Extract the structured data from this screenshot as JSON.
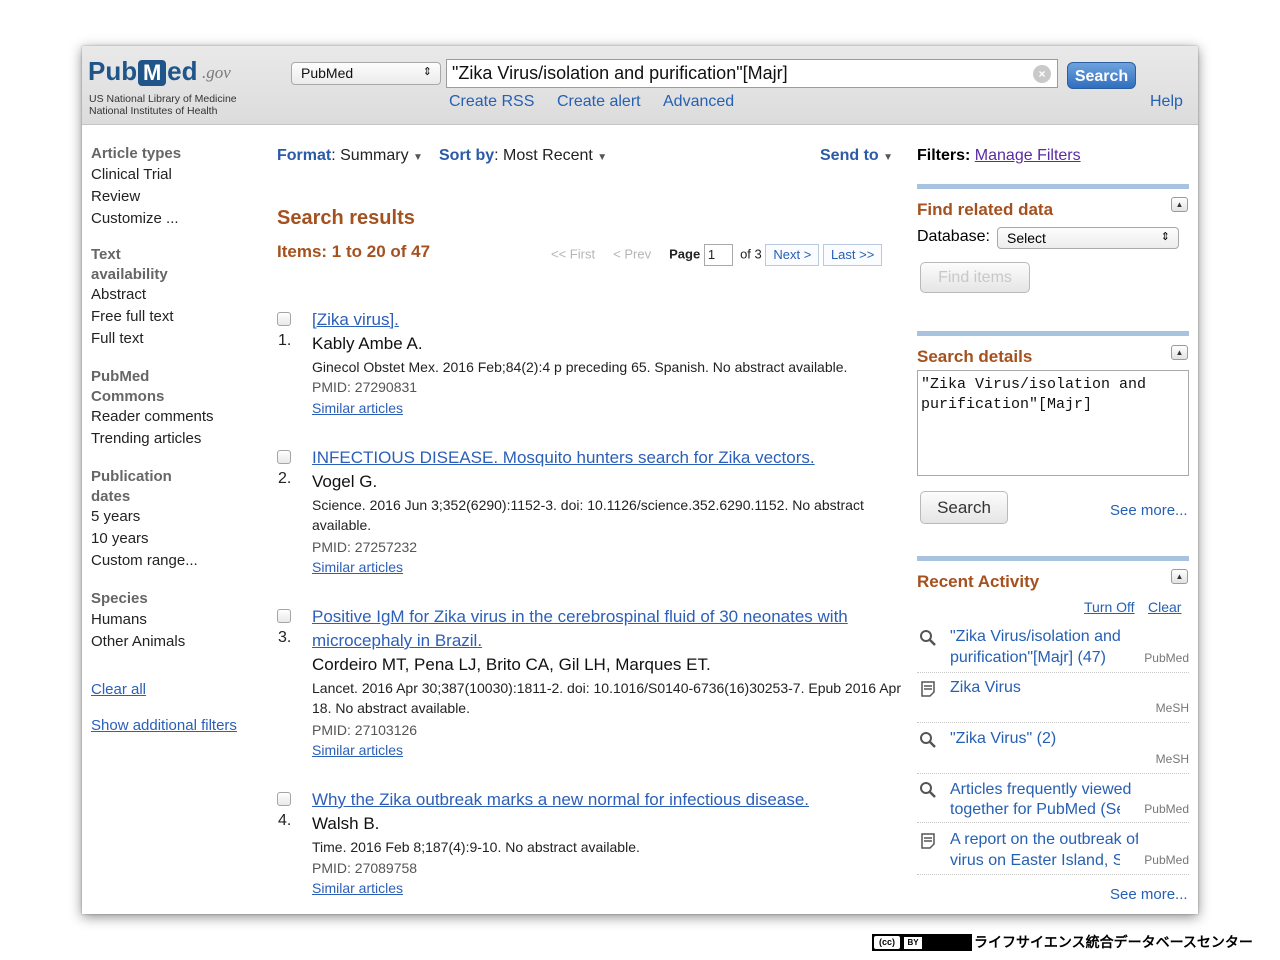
{
  "header": {
    "logo_text": "PubMed",
    "logo_gov": ".gov",
    "logo_line1": "US National Library of Medicine",
    "logo_line2": "National Institutes of Health",
    "database": "PubMed",
    "query": "\"Zika Virus/isolation and purification\"[Majr]",
    "search_label": "Search",
    "links": [
      "Create RSS",
      "Create alert",
      "Advanced"
    ],
    "help": "Help"
  },
  "sidebar": {
    "sections": [
      {
        "title": "Article types",
        "items": [
          "Clinical Trial",
          "Review",
          "Customize ..."
        ]
      },
      {
        "title": "Text availability",
        "items": [
          "Abstract",
          "Free full text",
          "Full text"
        ]
      },
      {
        "title": "PubMed Commons",
        "items": [
          "Reader comments",
          "Trending articles"
        ]
      },
      {
        "title": "Publication dates",
        "items": [
          "5 years",
          "10 years",
          "Custom range..."
        ]
      },
      {
        "title": "Species",
        "items": [
          "Humans",
          "Other Animals"
        ]
      }
    ],
    "clear_all": "Clear all",
    "show_filters": "Show additional filters"
  },
  "toolbar": {
    "format_label": "Format",
    "format_value": "Summary",
    "sort_label": "Sort by",
    "sort_value": "Most Recent",
    "send_to": "Send to"
  },
  "results_header": {
    "title": "Search results",
    "items_text": "Items: 1 to 20 of 47"
  },
  "pager": {
    "first": "<< First",
    "prev": "< Prev",
    "page_label": "Page",
    "page_value": "1",
    "of_text": "of 3",
    "next": "Next >",
    "last": "Last >>"
  },
  "results": [
    {
      "num": "1.",
      "title": "[Zika virus].",
      "authors": "Kably Ambe A.",
      "source": "Ginecol Obstet Mex. 2016 Feb;84(2):4 p preceding 65. Spanish. No abstract available.",
      "pmid": "PMID: 27290831",
      "similar": "Similar articles"
    },
    {
      "num": "2.",
      "title": "INFECTIOUS DISEASE. Mosquito hunters search for Zika vectors.",
      "authors": "Vogel G.",
      "source": "Science. 2016 Jun 3;352(6290):1152-3. doi: 10.1126/science.352.6290.1152. No abstract available.",
      "pmid": "PMID: 27257232",
      "similar": "Similar articles"
    },
    {
      "num": "3.",
      "title": "Positive IgM for Zika virus in the cerebrospinal fluid of 30 neonates with microcephaly in Brazil.",
      "authors": "Cordeiro MT, Pena LJ, Brito CA, Gil LH, Marques ET.",
      "source": "Lancet. 2016 Apr 30;387(10030):1811-2. doi: 10.1016/S0140-6736(16)30253-7. Epub 2016 Apr 18. No abstract available.",
      "pmid": "PMID: 27103126",
      "similar": "Similar articles"
    },
    {
      "num": "4.",
      "title": "Why the Zika outbreak marks a new normal for infectious disease.",
      "authors": "Walsh B.",
      "source": "Time. 2016 Feb 8;187(4):9-10. No abstract available.",
      "pmid": "PMID: 27089758",
      "similar": "Similar articles"
    }
  ],
  "right": {
    "filters_label": "Filters:",
    "manage_filters": "Manage Filters",
    "related_title": "Find related data",
    "database_label": "Database:",
    "database_value": "Select",
    "find_items": "Find items",
    "details_title": "Search details",
    "details_query": "\"Zika Virus/isolation and purification\"[Majr]",
    "details_search": "Search",
    "see_more": "See more...",
    "recent_title": "Recent Activity",
    "turn_off": "Turn Off",
    "clear": "Clear",
    "recent": [
      {
        "icon": "search-icon",
        "text1": "\"Zika Virus/isolation and",
        "text2": "purification\"[Majr] (47)",
        "src": "PubMed"
      },
      {
        "icon": "document-icon",
        "text1": "Zika Virus",
        "text2": "",
        "src": "MeSH"
      },
      {
        "icon": "search-icon",
        "text1": "\"Zika Virus\" (2)",
        "text2": "",
        "src": "MeSH"
      },
      {
        "icon": "search-icon",
        "text1": "Articles frequently viewed",
        "text2": "together for PubMed (Sele",
        "src": "PubMed"
      },
      {
        "icon": "document-icon",
        "text1": "A report on the outbreak of Zika",
        "text2": "virus on Easter Island, So",
        "src": "PubMed"
      }
    ],
    "recent_see_more": "See more..."
  },
  "footer": {
    "license_cc": "(cc)",
    "license_by": "BY",
    "credit": "ライフサイエンス統合データベースセンター"
  }
}
